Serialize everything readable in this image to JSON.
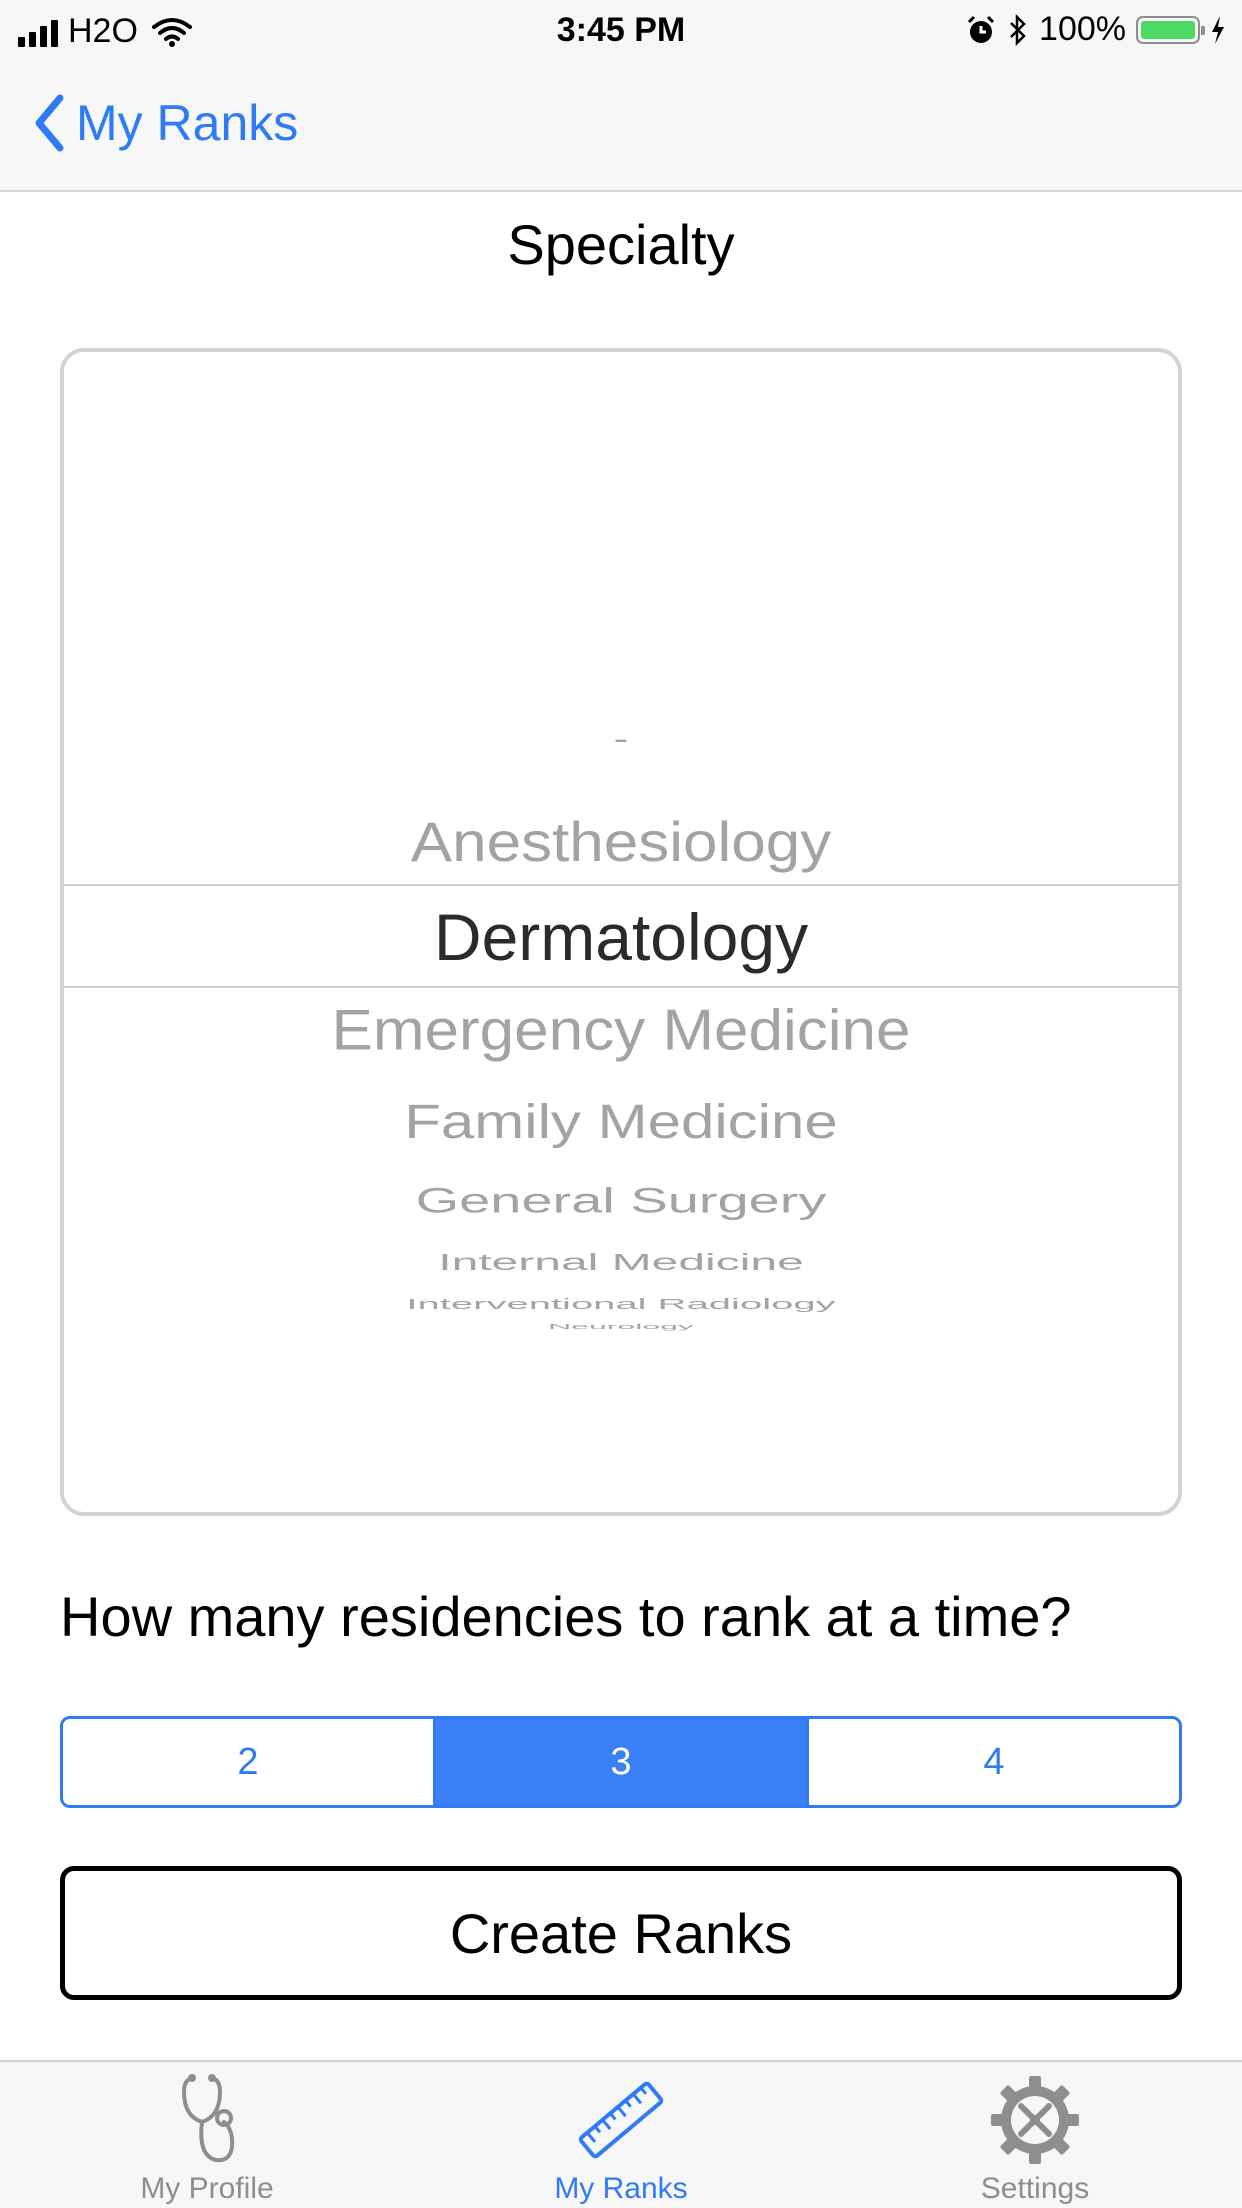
{
  "status_bar": {
    "carrier": "H2O",
    "time": "3:45 PM",
    "battery": "100%",
    "icons": [
      "signal-icon",
      "wifi-icon",
      "alarm-icon",
      "bluetooth-icon",
      "battery-icon",
      "charging-icon"
    ]
  },
  "nav": {
    "back_label": "My Ranks",
    "back_icon": "chevron-left-icon"
  },
  "specialty": {
    "title": "Specialty",
    "picker_items": [
      "-",
      "Anesthesiology",
      "Dermatology",
      "Emergency Medicine",
      "Family Medicine",
      "General Surgery",
      "Internal Medicine",
      "Interventional Radiology",
      "Neurology"
    ],
    "selected": "Dermatology"
  },
  "rank_count": {
    "question": "How many residencies to rank at a time?",
    "options": [
      "2",
      "3",
      "4"
    ],
    "selected": "3"
  },
  "create_button": {
    "label": "Create Ranks"
  },
  "tab_bar": {
    "tabs": [
      {
        "label": "My Profile",
        "icon": "stethoscope-icon"
      },
      {
        "label": "My Ranks",
        "icon": "ruler-icon"
      },
      {
        "label": "Settings",
        "icon": "gear-tools-icon"
      }
    ],
    "active": "My Ranks"
  },
  "colors": {
    "accent": "#2f7bf5",
    "segment_selected": "#3a7ff6",
    "picker_inactive": "#a3a3a3",
    "picker_selected": "#2b2b2b",
    "battery_green": "#4cd964"
  }
}
